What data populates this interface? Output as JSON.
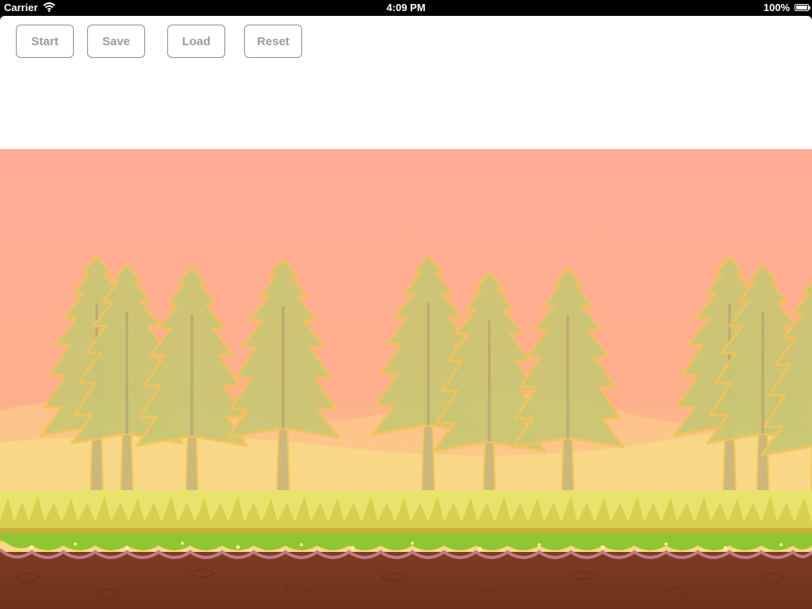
{
  "status_bar": {
    "carrier": "Carrier",
    "time": "4:09 PM",
    "battery": "100%"
  },
  "toolbar": {
    "start_label": "Start",
    "save_label": "Save",
    "load_label": "Load",
    "reset_label": "Reset"
  },
  "scene": {
    "description_colors": {
      "sky": "#ffac96",
      "grass": "#e8e26a",
      "moss": "#8fc832",
      "soil": "#7a3a20"
    }
  }
}
